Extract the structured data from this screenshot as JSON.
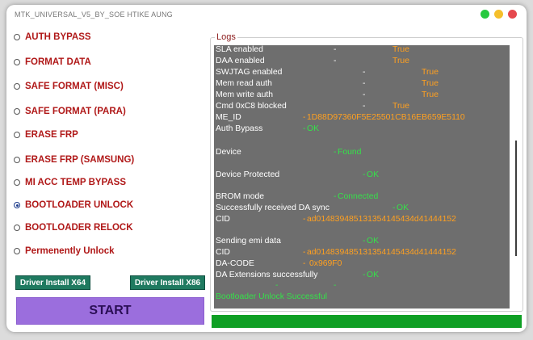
{
  "window": {
    "title": "MTK_UNIVERSAL_V5_BY_SOE HTIKE AUNG"
  },
  "colors": {
    "close": "#e5484d",
    "minimize": "#f5bf2b",
    "maximize": "#27c93f",
    "accent": "#9b6edd",
    "driver_button": "#1f7a60",
    "progress": "#0f9f24"
  },
  "options": [
    {
      "label": "AUTH BYPASS",
      "selected": false
    },
    {
      "label": "FORMAT DATA",
      "selected": false
    },
    {
      "label": "SAFE FORMAT (MISC)",
      "selected": false
    },
    {
      "label": "SAFE FORMAT (PARA)",
      "selected": false
    },
    {
      "label": "ERASE FRP",
      "selected": false
    },
    {
      "label": "ERASE FRP (SAMSUNG)",
      "selected": false
    },
    {
      "label": "MI ACC TEMP BYPASS",
      "selected": false
    },
    {
      "label": "BOOTLOADER UNLOCK",
      "selected": true
    },
    {
      "label": "BOOTLOADER RELOCK",
      "selected": false
    },
    {
      "label": "Permenently Unlock",
      "selected": false
    }
  ],
  "buttons": {
    "driver_x64": "Driver Install X64",
    "driver_x86": "Driver Install X86",
    "start": "START"
  },
  "logs": {
    "title": "Logs",
    "lines": [
      {
        "label": "SLA enabled",
        "sep": "-",
        "value": "True"
      },
      {
        "label": "DAA enabled",
        "sep": "-",
        "value": "True"
      },
      {
        "label": "SWJTAG enabled",
        "sep": "-",
        "value": "True"
      },
      {
        "label": "Mem read auth",
        "sep": "-",
        "value": "True"
      },
      {
        "label": "Mem write auth",
        "sep": "-",
        "value": "True"
      },
      {
        "label": "Cmd 0xC8 blocked",
        "sep": "-",
        "value": "True"
      },
      {
        "label": "ME_ID",
        "sep": "-",
        "value": "1D88D97360F5E25501CB16EB659E5110"
      },
      {
        "label": "Auth Bypass",
        "sep": "-",
        "value": "OK"
      },
      {
        "label": "Device",
        "sep": "-",
        "value": "Found"
      },
      {
        "label": "Device Protected",
        "sep": "-",
        "value": "OK"
      },
      {
        "label": "BROM mode",
        "sep": "-",
        "value": "Connected"
      },
      {
        "label": "Successfully received DA sync",
        "sep": "-",
        "value": "OK"
      },
      {
        "label": "CID",
        "sep": "-",
        "value": "ad014839485131354145434d41444152"
      },
      {
        "label": "Sending emi data",
        "sep": "-",
        "value": "OK"
      },
      {
        "label": "CID",
        "sep": "-",
        "value": "ad014839485131354145434d41444152"
      },
      {
        "label": "DA-CODE",
        "sep": "-",
        "value": "0x969F0"
      },
      {
        "label": "DA Extensions successfully",
        "sep": "-",
        "value": "OK"
      },
      {
        "label": "",
        "sep": "-",
        "value": "-"
      },
      {
        "label": "Bootloader Unlock Successful",
        "sep": "",
        "value": ""
      }
    ]
  },
  "progress": {
    "percent": 100
  }
}
